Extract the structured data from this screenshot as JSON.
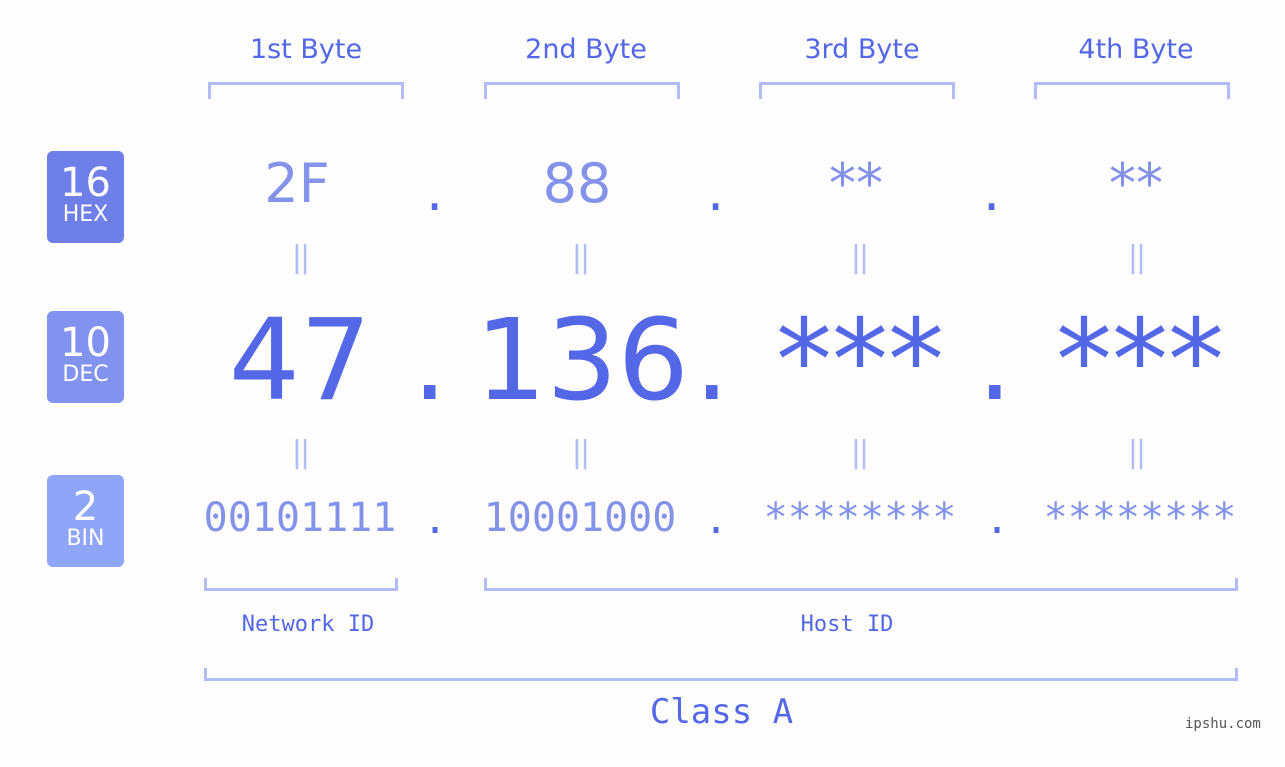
{
  "bytes": [
    {
      "header": "1st Byte",
      "hex": "2F",
      "dec": "47",
      "bin": "00101111"
    },
    {
      "header": "2nd Byte",
      "hex": "88",
      "dec": "136",
      "bin": "10001000"
    },
    {
      "header": "3rd Byte",
      "hex": "**",
      "dec": "***",
      "bin": "********"
    },
    {
      "header": "4th Byte",
      "hex": "**",
      "dec": "***",
      "bin": "********"
    }
  ],
  "separator": ".",
  "equals": "||",
  "badges": {
    "hex": {
      "number": "16",
      "label": "HEX",
      "color": "#6f7fe9"
    },
    "dec": {
      "number": "10",
      "label": "DEC",
      "color": "#8193ef"
    },
    "bin": {
      "number": "2",
      "label": "BIN",
      "color": "#8fa5f8"
    }
  },
  "network_label": "Network ID",
  "host_label": "Host ID",
  "class_label": "Class A",
  "watermark": "ipshu.com",
  "colors": {
    "accent": "#5468e7",
    "light": "#8492ea",
    "bracket": "#b2bcf6"
  }
}
